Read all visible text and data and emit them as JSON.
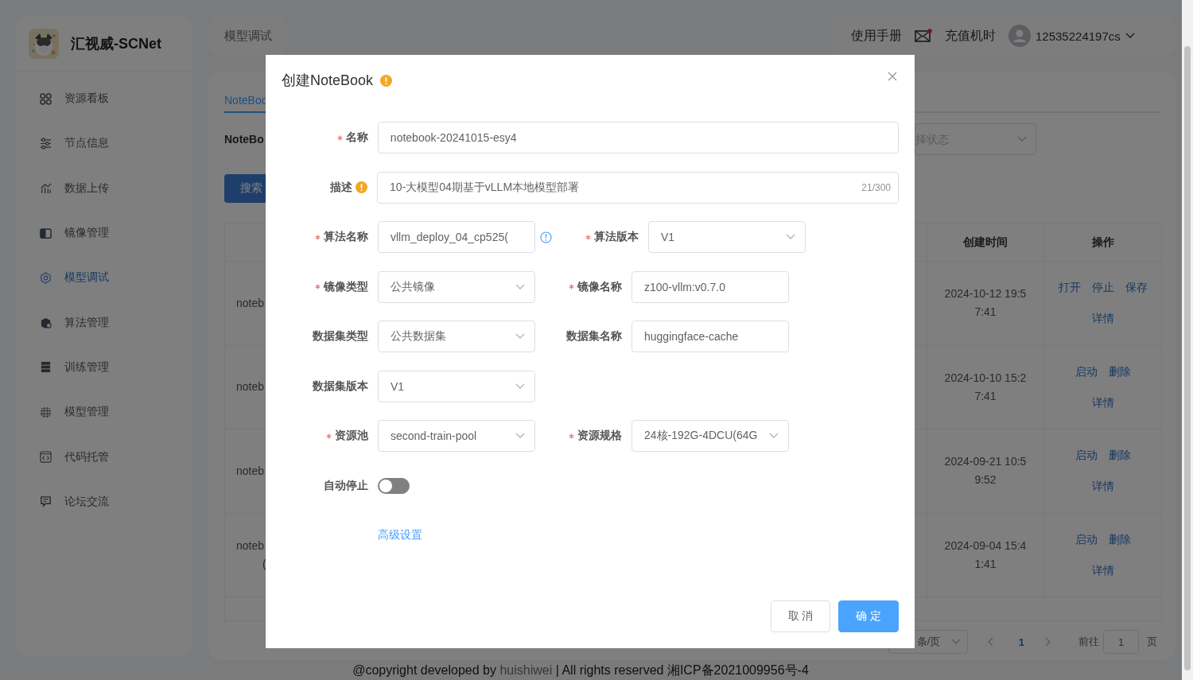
{
  "sidebar": {
    "title": "汇视威-SCNet",
    "items": [
      {
        "label": "资源看板",
        "selected": false
      },
      {
        "label": "节点信息",
        "selected": false
      },
      {
        "label": "数据上传",
        "selected": false
      },
      {
        "label": "镜像管理",
        "selected": false
      },
      {
        "label": "模型调试",
        "selected": true
      },
      {
        "label": "算法管理",
        "selected": false
      },
      {
        "label": "训练管理",
        "selected": false
      },
      {
        "label": "模型管理",
        "selected": false
      },
      {
        "label": "代码托管",
        "selected": false
      },
      {
        "label": "论坛交流",
        "selected": false
      }
    ]
  },
  "header": {
    "breadcrumb": "模型调试",
    "manual": "使用手册",
    "mail": {
      "unread": true
    },
    "recharge": "充值机时",
    "user": "12535224197cs"
  },
  "content": {
    "tabs": [
      {
        "label": "NoteBoo",
        "selected": true
      }
    ],
    "filter_label": "NoteBo",
    "status_select": {
      "placeholder": "择状态"
    },
    "search_button": "搜索",
    "table": {
      "columns": [
        "创建时间",
        "操作"
      ],
      "rows": [
        {
          "column_1": [
            "noteb"
          ],
          "created": [
            "2024-10-12 19:5",
            "7:41"
          ],
          "actions": [
            [
              "打开",
              "停止",
              "保存"
            ],
            [
              "详情"
            ]
          ]
        },
        {
          "column_1": [
            "noteb"
          ],
          "created": [
            "2024-10-10 15:2",
            "7:41"
          ],
          "actions": [
            [
              "启动",
              "删除"
            ],
            [
              "详情"
            ]
          ]
        },
        {
          "column_1": [
            "noteb"
          ],
          "created": [
            "2024-09-21 10:5",
            "9:52"
          ],
          "actions": [
            [
              "启动",
              "删除"
            ],
            [
              "详情"
            ]
          ]
        },
        {
          "column_1": [
            "noteb",
            "("
          ],
          "created": [
            "2024-09-04 15:4",
            "1:41"
          ],
          "actions": [
            [
              "启动",
              "删除"
            ],
            [
              "详情"
            ]
          ]
        }
      ]
    },
    "pagination": {
      "page_size": "条/页",
      "pages": [
        {
          "label": "1",
          "selected": true
        }
      ],
      "goto_label": "前往",
      "goto_value": "1",
      "page_suffix": "页"
    }
  },
  "footer": {
    "before": "@copyright developed by",
    "link": "huishiwei",
    "after": "| All rights reserved 湘ICP备2021009956号-4"
  },
  "dialog": {
    "title": "创建NoteBook",
    "title_hint": true,
    "rows": [
      {
        "items": [
          {
            "kind": "text",
            "label": "名称",
            "required": true,
            "value": "notebook-20241015-esy4"
          }
        ]
      },
      {
        "items": [
          {
            "kind": "counter",
            "label": "描述",
            "required": false,
            "hint": true,
            "value": "10-大模型04期基于vLLM本地模型部署",
            "counter": "21/300"
          }
        ]
      },
      {
        "items": [
          {
            "kind": "text",
            "label": "算法名称",
            "required": true,
            "value": "vllm_deploy_04_cp525(",
            "info": true
          },
          {
            "kind": "select",
            "label": "算法版本",
            "required": true,
            "value": "V1"
          }
        ]
      },
      {
        "items": [
          {
            "kind": "select",
            "label": "镜像类型",
            "required": true,
            "value": "公共镜像"
          },
          {
            "kind": "text",
            "label": "镜像名称",
            "required": true,
            "value": "z100-vllm:v0.7.0"
          }
        ]
      },
      {
        "items": [
          {
            "kind": "select",
            "label": "数据集类型",
            "required": false,
            "value": "公共数据集"
          },
          {
            "kind": "text",
            "label": "数据集名称",
            "required": false,
            "value": "huggingface-cache"
          }
        ]
      },
      {
        "items": [
          {
            "kind": "select",
            "label": "数据集版本",
            "required": false,
            "value": "V1"
          }
        ]
      },
      {
        "items": [
          {
            "kind": "select",
            "label": "资源池",
            "required": true,
            "value": "second-train-pool"
          },
          {
            "kind": "select",
            "label": "资源规格",
            "required": true,
            "value": "24核-192G-4DCU(64G"
          }
        ]
      },
      {
        "items": [
          {
            "kind": "switch",
            "label": "自动停止",
            "required": false,
            "on": false
          }
        ]
      },
      {
        "items": [
          {
            "kind": "link",
            "value": "高级设置"
          }
        ]
      }
    ],
    "buttons": [
      {
        "label": "取 消",
        "kind": "default"
      },
      {
        "label": "确 定",
        "kind": "primary"
      }
    ]
  }
}
